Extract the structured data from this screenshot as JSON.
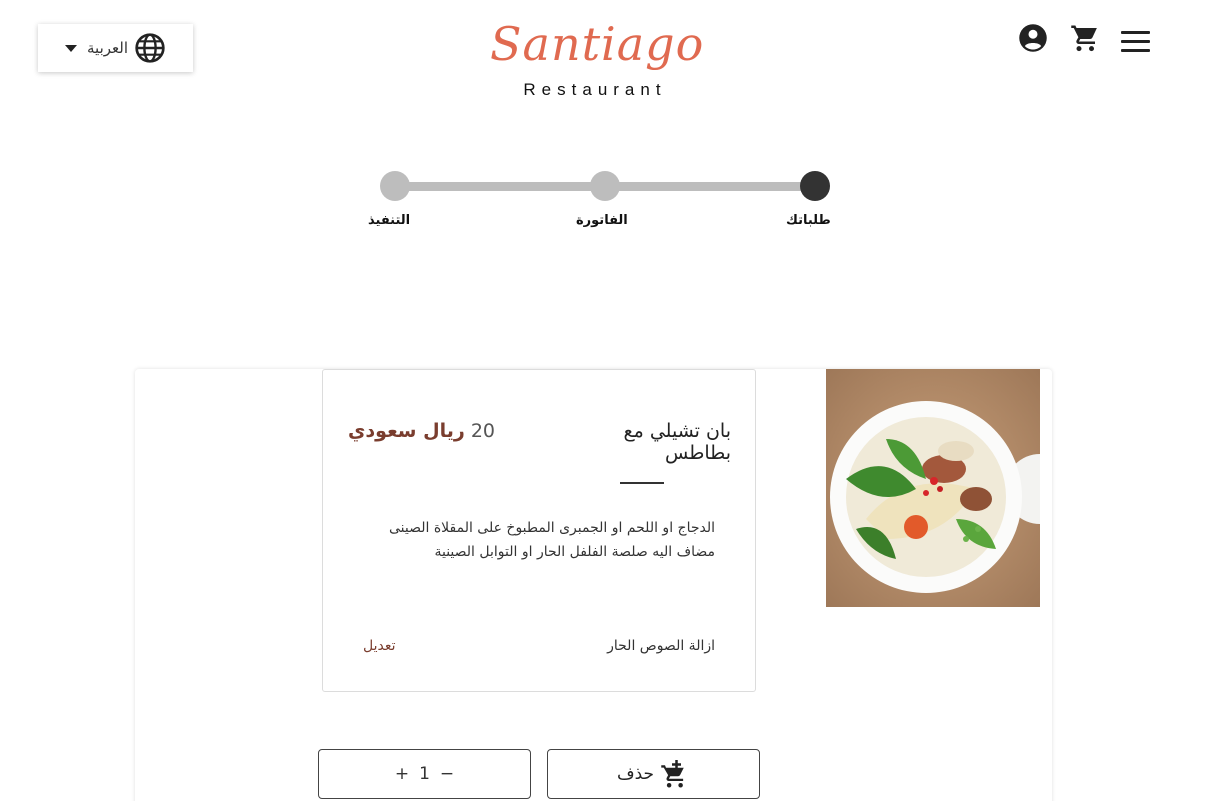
{
  "header": {
    "language_label": "العربية",
    "logo_script": "Santiago",
    "logo_sub": "Restaurant"
  },
  "stepper": {
    "steps": [
      {
        "label": "طلباتك",
        "active": true
      },
      {
        "label": "الفاتورة",
        "active": false
      },
      {
        "label": "التنفيذ",
        "active": false
      }
    ]
  },
  "item": {
    "name": "بان تشيلي مع بطاطس",
    "price_amount": "20",
    "price_currency": "ريال سعودي",
    "description": "الدجاج او اللحم او الجمبرى المطبوخ على المقلاة الصينى مضاف اليه صلصة الفلفل الحار او التوابل الصينية",
    "extras": "ازالة الصوص الحار",
    "edit_label": "تعديل"
  },
  "actions": {
    "delete_label": "حذف",
    "minus": "−",
    "quantity": "1",
    "plus": "+"
  },
  "colors": {
    "accent": "#e06a50",
    "price": "#7a3d2e",
    "active_step": "#333333",
    "inactive_step": "#bdbdbd"
  }
}
